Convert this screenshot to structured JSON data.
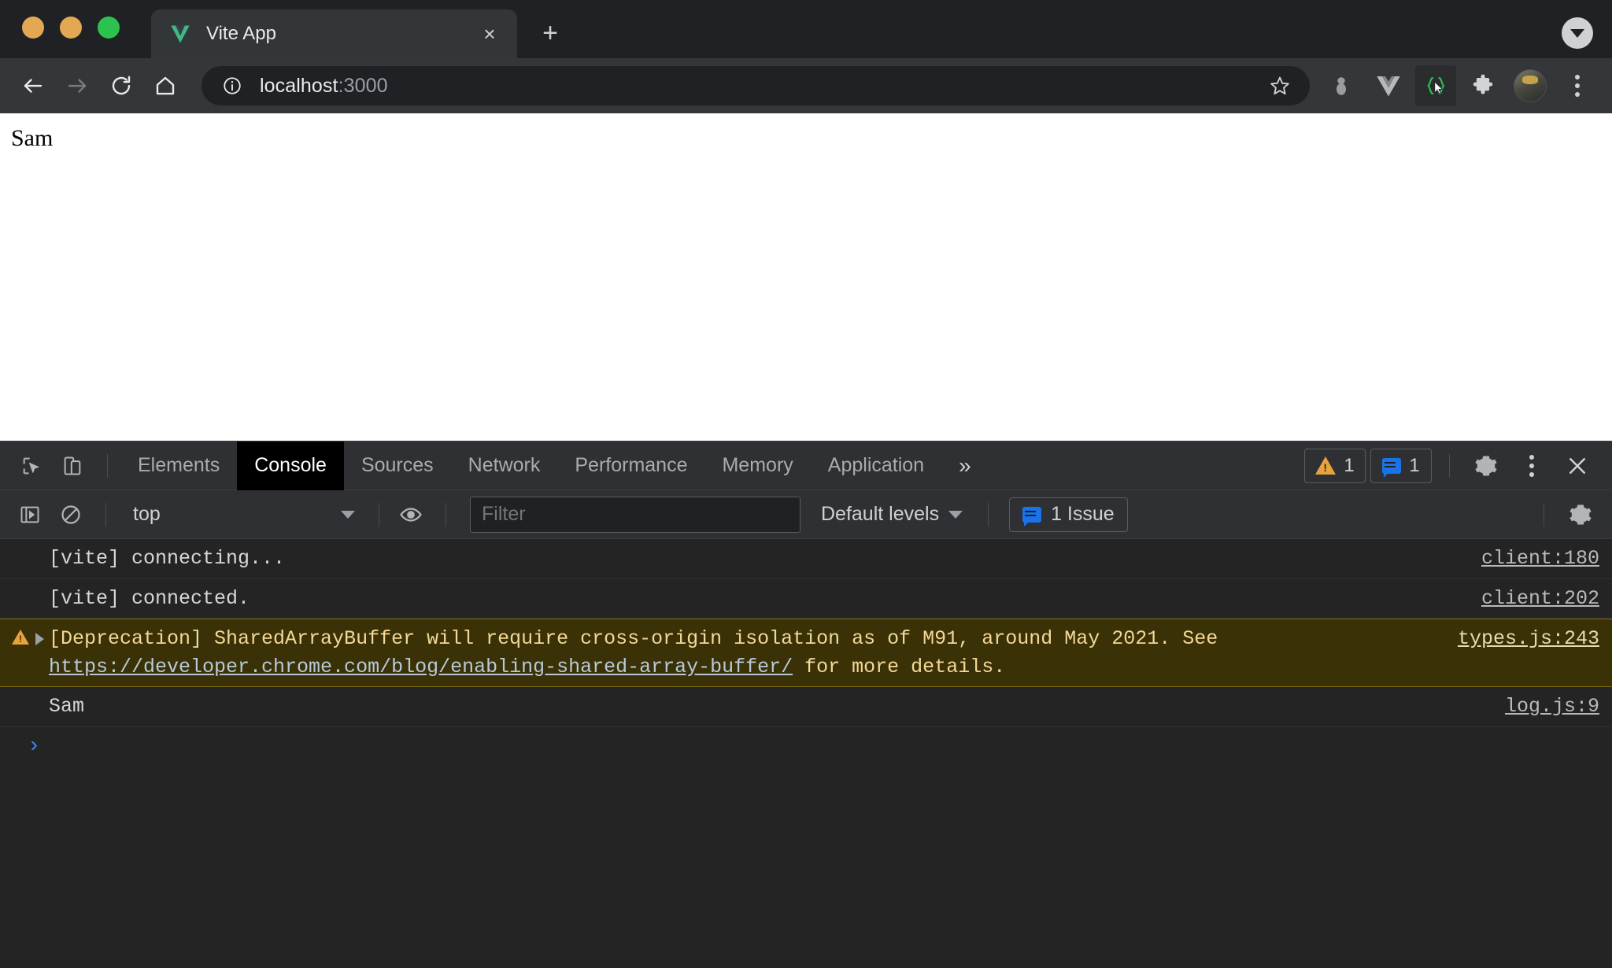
{
  "window": {
    "traffic_lights": [
      "close",
      "minimize",
      "zoom"
    ]
  },
  "tabstrip": {
    "tab_title": "Vite App",
    "favicon": "vite-logo-icon",
    "close_label": "×",
    "newtab_label": "+",
    "tab_search": "tab-search-icon"
  },
  "toolbar": {
    "back": "back-arrow-icon",
    "forward": "forward-arrow-icon",
    "reload": "reload-icon",
    "home": "home-icon",
    "site_info": "info-icon",
    "url_host": "localhost",
    "url_port": ":3000",
    "bookmark": "star-icon",
    "extensions": [
      "bug-extension-icon",
      "vue-devtools-icon",
      "json-cursor-icon",
      "puzzle-extensions-icon"
    ],
    "avatar": "profile-avatar",
    "menu": "kebab-menu-icon"
  },
  "page": {
    "body_text": "Sam"
  },
  "devtools": {
    "inspect_icon": "inspect-element-icon",
    "device_icon": "device-toolbar-icon",
    "tabs": [
      {
        "label": "Elements",
        "active": false
      },
      {
        "label": "Console",
        "active": true
      },
      {
        "label": "Sources",
        "active": false
      },
      {
        "label": "Network",
        "active": false
      },
      {
        "label": "Performance",
        "active": false
      },
      {
        "label": "Memory",
        "active": false
      },
      {
        "label": "Application",
        "active": false
      }
    ],
    "overflow_label": "»",
    "warning_count": "1",
    "message_count": "1",
    "settings_icon": "gear-icon",
    "more_icon": "kebab-menu-icon",
    "close_icon": "close-icon",
    "console_toolbar": {
      "sidebar_toggle": "console-sidebar-icon",
      "clear_console": "clear-console-icon",
      "context": "top",
      "eye_icon": "live-expression-eye-icon",
      "filter_placeholder": "Filter",
      "filter_value": "",
      "levels_label": "Default levels",
      "issue_label": "1 Issue",
      "settings_icon": "gear-icon"
    },
    "messages": [
      {
        "type": "log",
        "text": "[vite] connecting...",
        "source": "client:180"
      },
      {
        "type": "log",
        "text": "[vite] connected.",
        "source": "client:202"
      },
      {
        "type": "warning",
        "text_before": "[Deprecation] SharedArrayBuffer will require cross-origin isolation as of M91, around May 2021. See ",
        "link": "https://developer.chrome.com/blog/enabling-shared-array-buffer/",
        "text_after": " for more details.",
        "source": "types.js:243"
      },
      {
        "type": "log",
        "text": "Sam",
        "source": "log.js:9"
      }
    ],
    "prompt_caret": "›",
    "prompt_value": ""
  },
  "colors": {
    "chrome_bg": "#202124",
    "toolbar_bg": "#35363a",
    "tab_active": "#323639",
    "devtools_bg": "#242424",
    "devtools_toolbar": "#2f3033",
    "warning_bg": "#3a3206",
    "warning_text": "#f4d899",
    "accent_blue": "#1a73e8",
    "prompt_blue": "#2a8fff",
    "vite_green": "#41b883"
  }
}
